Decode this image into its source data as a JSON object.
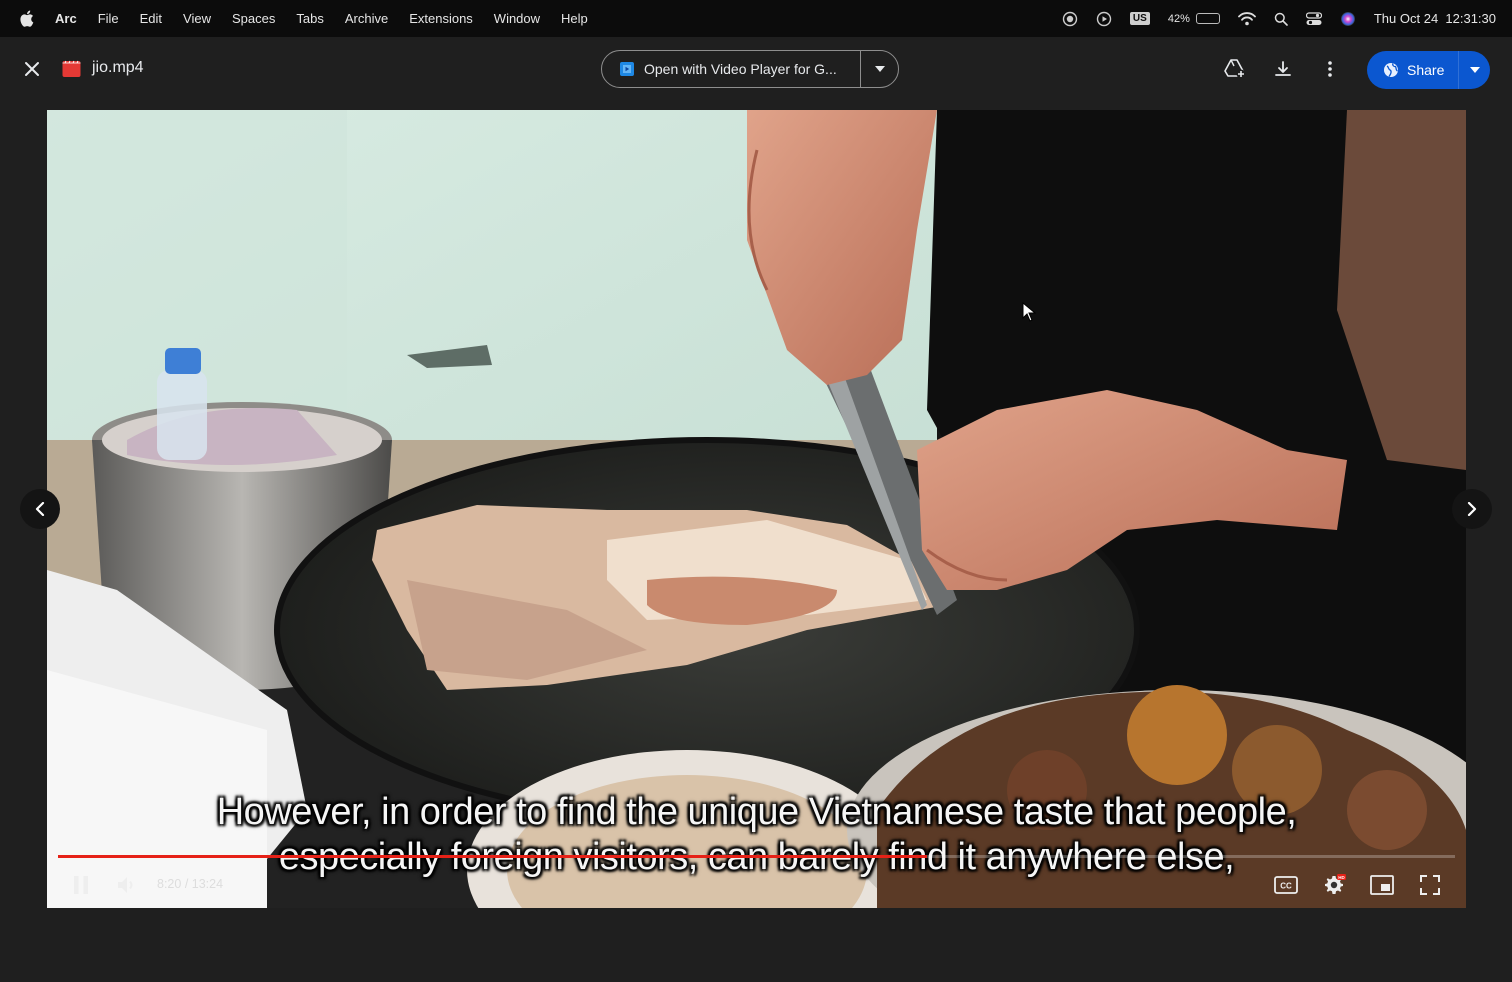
{
  "menubar": {
    "app": "Arc",
    "items": [
      "File",
      "Edit",
      "View",
      "Spaces",
      "Tabs",
      "Archive",
      "Extensions",
      "Window",
      "Help"
    ],
    "input_source": "US",
    "battery": "42%",
    "battery_level": 0.42,
    "datetime": "Thu Oct 24  12:31:30"
  },
  "viewer": {
    "file_name": "jio.mp4",
    "open_with_label": "Open with Video Player for G...",
    "share_label": "Share",
    "accent": "#0b57d0"
  },
  "video": {
    "subtitle_line1": "However, in order to find the unique Vietnamese taste that people,",
    "subtitle_line2": "especially foreign visitors, can barely find it anywhere else,",
    "current_time": "8:20",
    "duration": "13:24",
    "time_display": "8:20 / 13:24",
    "progress": 0.622,
    "progress_color": "#e62117"
  },
  "icons": {
    "close": "close-icon",
    "file": "video-file-icon",
    "add_to_drive": "add-to-drive-icon",
    "download": "download-icon",
    "more": "more-vert-icon",
    "prev": "chevron-left-icon",
    "next": "chevron-right-icon"
  }
}
